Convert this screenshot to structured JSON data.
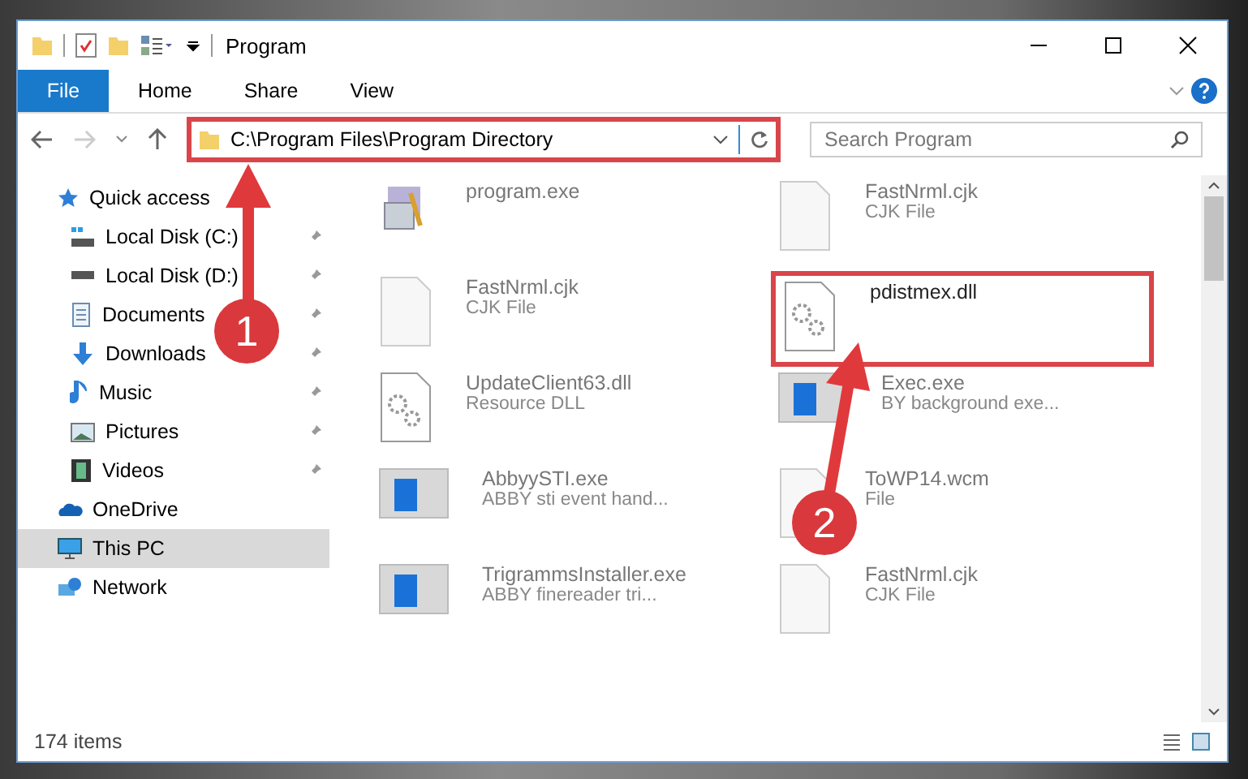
{
  "window": {
    "title": "Program"
  },
  "ribbon": {
    "file_button": "File",
    "tabs": [
      "Home",
      "Share",
      "View"
    ]
  },
  "address_bar": {
    "path": "C:\\Program Files\\Program Directory",
    "highlighted": true
  },
  "search": {
    "placeholder": "Search Program"
  },
  "nav": [
    {
      "label": "Quick access",
      "kind": "star",
      "selected": false,
      "children": [
        {
          "label": "Local Disk (C:)",
          "kind": "drive-c",
          "pinned": true
        },
        {
          "label": "Local Disk (D:)",
          "kind": "drive",
          "pinned": true
        },
        {
          "label": "Documents",
          "kind": "documents",
          "pinned": true
        },
        {
          "label": "Downloads",
          "kind": "downloads",
          "pinned": true
        },
        {
          "label": "Music",
          "kind": "music",
          "pinned": true
        },
        {
          "label": "Pictures",
          "kind": "pictures",
          "pinned": true
        },
        {
          "label": "Videos",
          "kind": "videos",
          "pinned": true
        }
      ]
    },
    {
      "label": "OneDrive",
      "kind": "cloud",
      "selected": false
    },
    {
      "label": "This PC",
      "kind": "pc",
      "selected": true
    },
    {
      "label": "Network",
      "kind": "network",
      "selected": false
    }
  ],
  "files": [
    {
      "name": "program.exe",
      "kind": "installer",
      "highlighted": false
    },
    {
      "name": "FastNrml.cjk",
      "type": "CJK File",
      "kind": "blank",
      "highlighted": false
    },
    {
      "name": "FastNrml.cjk",
      "type": "CJK File",
      "kind": "blank",
      "highlighted": false
    },
    {
      "name": "pdistmex.dll",
      "kind": "gears",
      "highlighted": true
    },
    {
      "name": "UpdateClient63.dll",
      "type": "Resource DLL",
      "kind": "gears",
      "highlighted": false
    },
    {
      "name": "Exec.exe",
      "type": "BY background exe...",
      "kind": "app",
      "highlighted": false
    },
    {
      "name": "AbbyySTI.exe",
      "type": "ABBY sti event hand...",
      "kind": "app",
      "highlighted": false
    },
    {
      "name": "ToWP14.wcm",
      "type": "File",
      "kind": "blank",
      "highlighted": false
    },
    {
      "name": "TrigrammsInstaller.exe",
      "type": "ABBY finereader tri...",
      "kind": "app",
      "highlighted": false
    },
    {
      "name": "FastNrml.cjk",
      "type": "CJK File",
      "kind": "blank",
      "highlighted": false
    }
  ],
  "status_bar": "174 items",
  "annotations": [
    {
      "number": "1"
    },
    {
      "number": "2"
    }
  ]
}
